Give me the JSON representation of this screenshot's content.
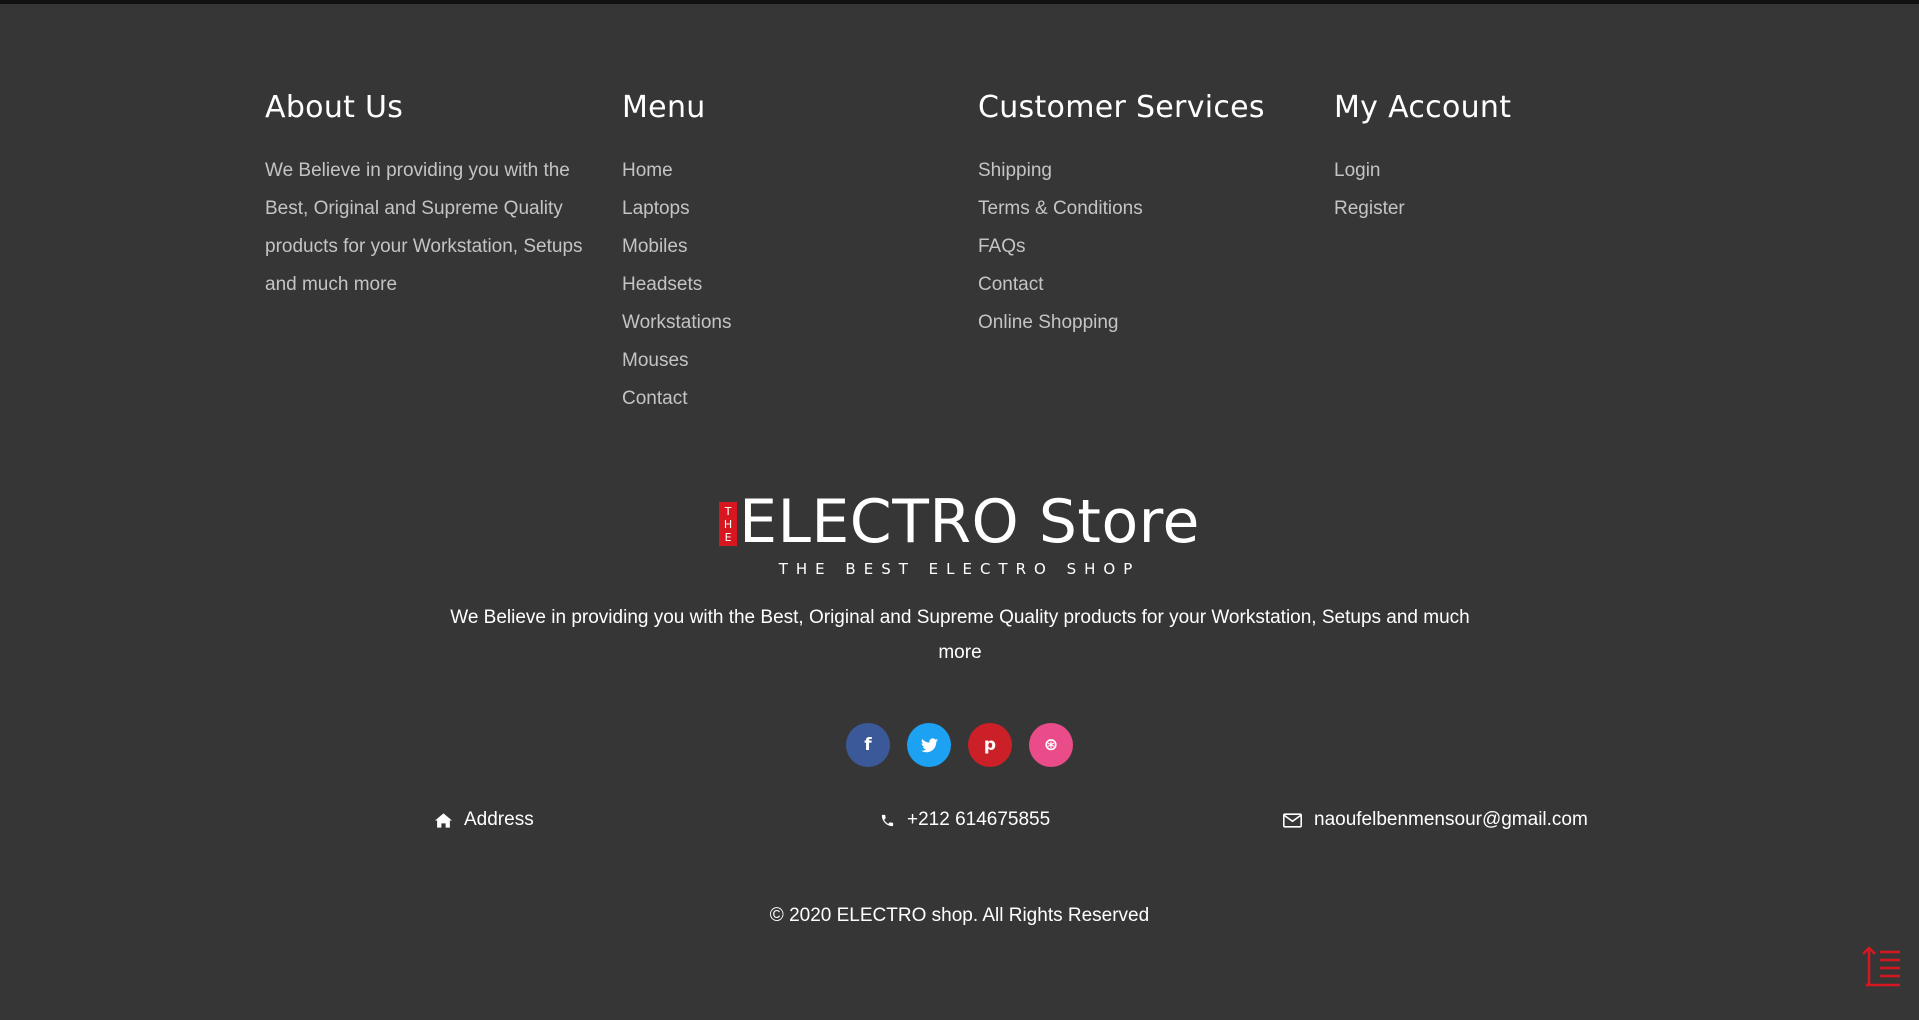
{
  "columns": {
    "about": {
      "title": "About Us",
      "text": "We Believe in providing you with the Best, Original and Supreme Quality products for your Workstation, Setups and much more"
    },
    "menu": {
      "title": "Menu",
      "items": [
        "Home",
        "Laptops",
        "Mobiles",
        "Headsets",
        "Workstations",
        "Mouses",
        "Contact"
      ]
    },
    "customer_services": {
      "title": "Customer Services",
      "items": [
        "Shipping",
        "Terms & Conditions",
        "FAQs",
        "Contact",
        "Online Shopping"
      ]
    },
    "my_account": {
      "title": "My Account",
      "items": [
        "Login",
        "Register"
      ]
    }
  },
  "brand": {
    "tag_letters": [
      "T",
      "H",
      "E"
    ],
    "name": "ELECTRO Store",
    "tagline": "THE BEST ELECTRO SHOP",
    "description": "We Believe in providing you with the Best, Original and Supreme Quality products for your Workstation, Setups and much more"
  },
  "social": [
    {
      "name": "facebook",
      "glyph": "f",
      "icon": "facebook-icon",
      "color": "#3b5998"
    },
    {
      "name": "twitter",
      "glyph": "t",
      "icon": "twitter-icon",
      "color": "#1da1f2"
    },
    {
      "name": "pinterest",
      "glyph": "p",
      "icon": "pinterest-icon",
      "color": "#cb2027"
    },
    {
      "name": "dribbble",
      "glyph": "⊛",
      "icon": "dribbble-icon",
      "color": "#ea4c89"
    }
  ],
  "contact": {
    "address": "Address",
    "phone": "+212 614675855",
    "email": "naoufelbenmensour@gmail.com"
  },
  "copyright": "© 2020 ELECTRO shop. All Rights Reserved",
  "colors": {
    "background": "#363636",
    "accent": "#d7171f",
    "heading": "#ffffff",
    "link": "#c4c4c4"
  }
}
